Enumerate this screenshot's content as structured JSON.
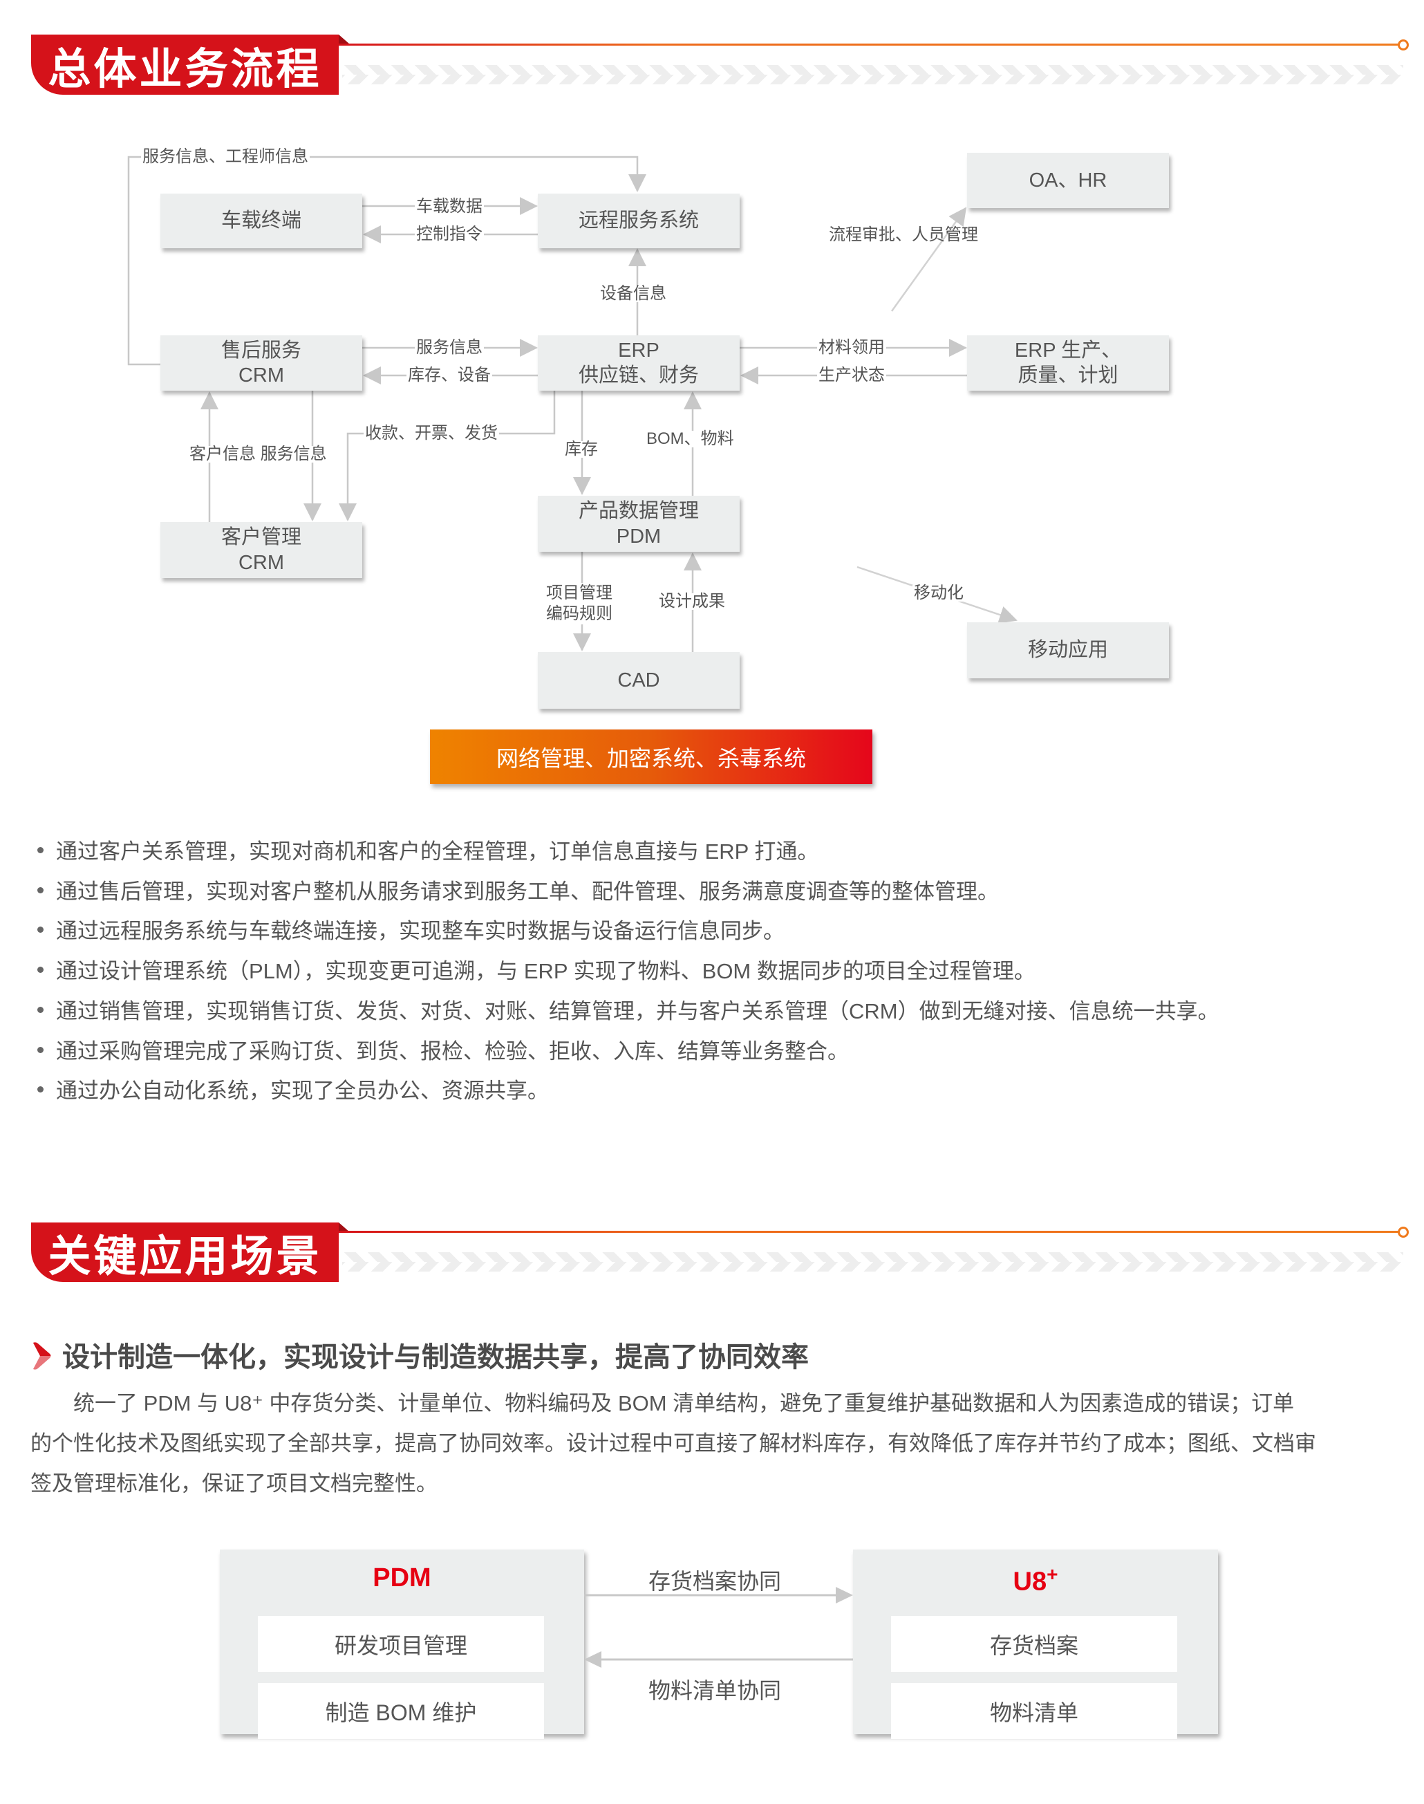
{
  "section1": {
    "title": "总体业务流程"
  },
  "diagram": {
    "boxes": {
      "vehicle_terminal": "车载终端",
      "remote_service": "远程服务系统",
      "oa_hr": "OA、HR",
      "aftersales_l1": "售后服务",
      "aftersales_l2": "CRM",
      "erp_l1": "ERP",
      "erp_l2": "供应链、财务",
      "erp_prod_l1": "ERP 生产、",
      "erp_prod_l2": "质量、计划",
      "customer_l1": "客户管理",
      "customer_l2": "CRM",
      "pdm_l1": "产品数据管理",
      "pdm_l2": "PDM",
      "cad": "CAD",
      "mobile_app": "移动应用"
    },
    "labels": {
      "service_engineer_info": "服务信息、工程师信息",
      "vehicle_data": "车载数据",
      "control_command": "控制指令",
      "device_info": "设备信息",
      "approval_personnel": "流程审批、人员管理",
      "service_info": "服务信息",
      "inventory_device": "库存、设备",
      "material_requisition": "材料领用",
      "production_status": "生产状态",
      "payment_invoice_delivery": "收款、开票、发货",
      "customer_service_info": "客户信息 服务信息",
      "inventory": "库存",
      "bom_material": "BOM、物料",
      "project_mgmt_l1": "项目管理",
      "project_mgmt_l2": "编码规则",
      "design_result": "设计成果",
      "mobilization": "移动化"
    },
    "security_bar": "网络管理、加密系统、杀毒系统"
  },
  "bullets": [
    "通过客户关系管理，实现对商机和客户的全程管理，订单信息直接与 ERP 打通。",
    "通过售后管理，实现对客户整机从服务请求到服务工单、配件管理、服务满意度调查等的整体管理。",
    "通过远程服务系统与车载终端连接，实现整车实时数据与设备运行信息同步。",
    "通过设计管理系统（PLM），实现变更可追溯，与 ERP 实现了物料、BOM 数据同步的项目全过程管理。",
    "通过销售管理，实现销售订货、发货、对货、对账、结算管理，并与客户关系管理（CRM）做到无缝对接、信息统一共享。",
    "通过采购管理完成了采购订货、到货、报检、检验、拒收、入库、结算等业务整合。",
    "通过办公自动化系统，实现了全员办公、资源共享。"
  ],
  "section2": {
    "title": "关键应用场景",
    "subheading": "设计制造一体化，实现设计与制造数据共享，提高了协同效率",
    "paragraph_lines": [
      "　　统一了 PDM 与 U8⁺ 中存货分类、计量单位、物料编码及 BOM 清单结构，避免了重复维护基础数据和人为因素造成的错误；订单",
      "的个性化技术及图纸实现了全部共享，提高了协同效率。设计过程中可直接了解材料库存，有效降低了库存并节约了成本；图纸、文档审",
      "签及管理标准化，保证了项目文档完整性。"
    ]
  },
  "sync_diagram": {
    "left": {
      "title": "PDM",
      "items": [
        "研发项目管理",
        "制造 BOM 维护"
      ]
    },
    "right": {
      "title": "U8",
      "title_sup": "+",
      "items": [
        "存货档案",
        "物料清单"
      ]
    },
    "arrow_right_label": "存货档案协同",
    "arrow_left_label": "物料清单协同"
  },
  "colors": {
    "brand_red": "#d5121a",
    "accent_orange": "#f07a1c",
    "box_gray": "#eceeee",
    "connector_gray": "#c8c8c8",
    "text_gray": "#555555",
    "title_red": "#e60012"
  }
}
